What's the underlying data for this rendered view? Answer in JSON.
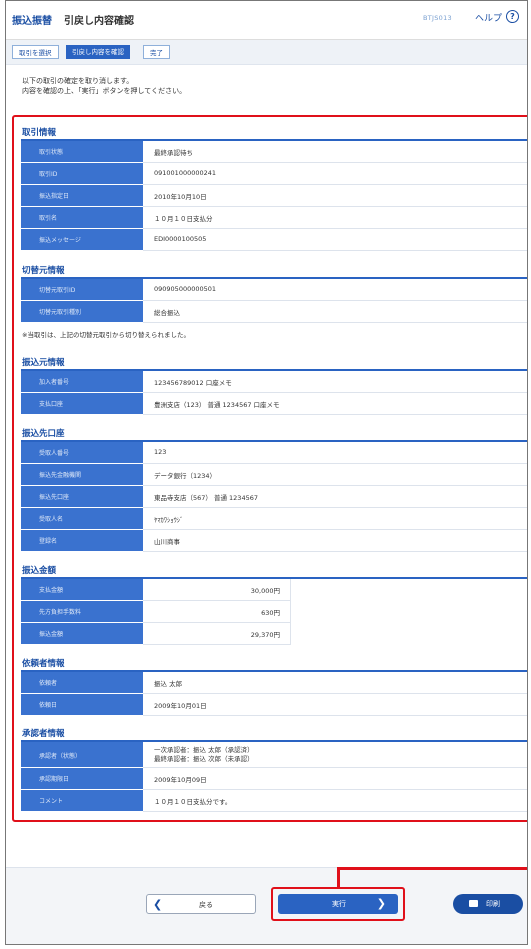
{
  "header": {
    "module": "振込振替",
    "title": "引戻し内容確認",
    "screen_id": "BTJS013",
    "help_label": "ヘルプ",
    "help_icon": "?"
  },
  "steps": [
    {
      "label": "取引を選択"
    },
    {
      "label": "引戻し内容を確認"
    },
    {
      "label": "完了"
    }
  ],
  "intro": {
    "line1": "以下の取引の確定を取り消します。",
    "line2": "内容を確認の上、「実行」ボタンを押してください。"
  },
  "sections": {
    "torihiki": {
      "title": "取引情報",
      "rows": [
        {
          "label": "取引状態",
          "value": "最終承認待ち"
        },
        {
          "label": "取引ID",
          "value": "091001000000241"
        },
        {
          "label": "振込指定日",
          "value": "2010年10月10日"
        },
        {
          "label": "取引名",
          "value": "１０月１０日支払分"
        },
        {
          "label": "振込メッセージ",
          "value": "EDI0000100505"
        }
      ]
    },
    "kirikae": {
      "title": "切替元情報",
      "rows": [
        {
          "label": "切替元取引ID",
          "value": "090905000000501"
        },
        {
          "label": "切替元取引種別",
          "value": "総合振込"
        }
      ],
      "note": "※当取引は、上記の切替元取引から切り替えられました。"
    },
    "furikomimoto": {
      "title": "振込元情報",
      "rows": [
        {
          "label": "加入者番号",
          "value": "123456789012 口座メモ"
        },
        {
          "label": "支払口座",
          "value": "豊洲支店（123） 普通 1234567 口座メモ"
        }
      ]
    },
    "furikomisaki": {
      "title": "振込先口座",
      "rows": [
        {
          "label": "受取人番号",
          "value": "123"
        },
        {
          "label": "振込先金融機関",
          "value": "データ銀行（1234）"
        },
        {
          "label": "振込先口座",
          "value": "東品寺支店（567） 普通 1234567"
        },
        {
          "label": "受取人名",
          "value": "ﾔﾏｶﾜｼｮｳｼﾞ"
        },
        {
          "label": "登録名",
          "value": "山川商事"
        }
      ]
    },
    "kingaku": {
      "title": "振込金額",
      "rows": [
        {
          "label": "支払金額",
          "value": "30,000円"
        },
        {
          "label": "先方負担手数料",
          "value": "630円"
        },
        {
          "label": "振込金額",
          "value": "29,370円"
        }
      ]
    },
    "irai": {
      "title": "依頼者情報",
      "rows": [
        {
          "label": "依頼者",
          "value": "振込 太郎"
        },
        {
          "label": "依頼日",
          "value": "2009年10月01日"
        }
      ]
    },
    "shonin": {
      "title": "承認者情報",
      "approver_label": "承認者（状態）",
      "approver_line1": "一次承認者：振込 太郎（承認済）",
      "approver_line2": "最終承認者：振込 次郎（未承認）",
      "rows": [
        {
          "label": "承認期限日",
          "value": "2009年10月09日"
        },
        {
          "label": "コメント",
          "value": "１０月１０日支払分です。"
        }
      ]
    }
  },
  "footer": {
    "back_label": "戻る",
    "back_icon": "chevron-left",
    "execute_label": "実行",
    "execute_icon": "chevron-right",
    "print_label": "印刷",
    "print_icon": "printer"
  },
  "colors": {
    "accent": "#2a63c2",
    "label_bg": "#3a72cf",
    "highlight": "#e0101a"
  }
}
